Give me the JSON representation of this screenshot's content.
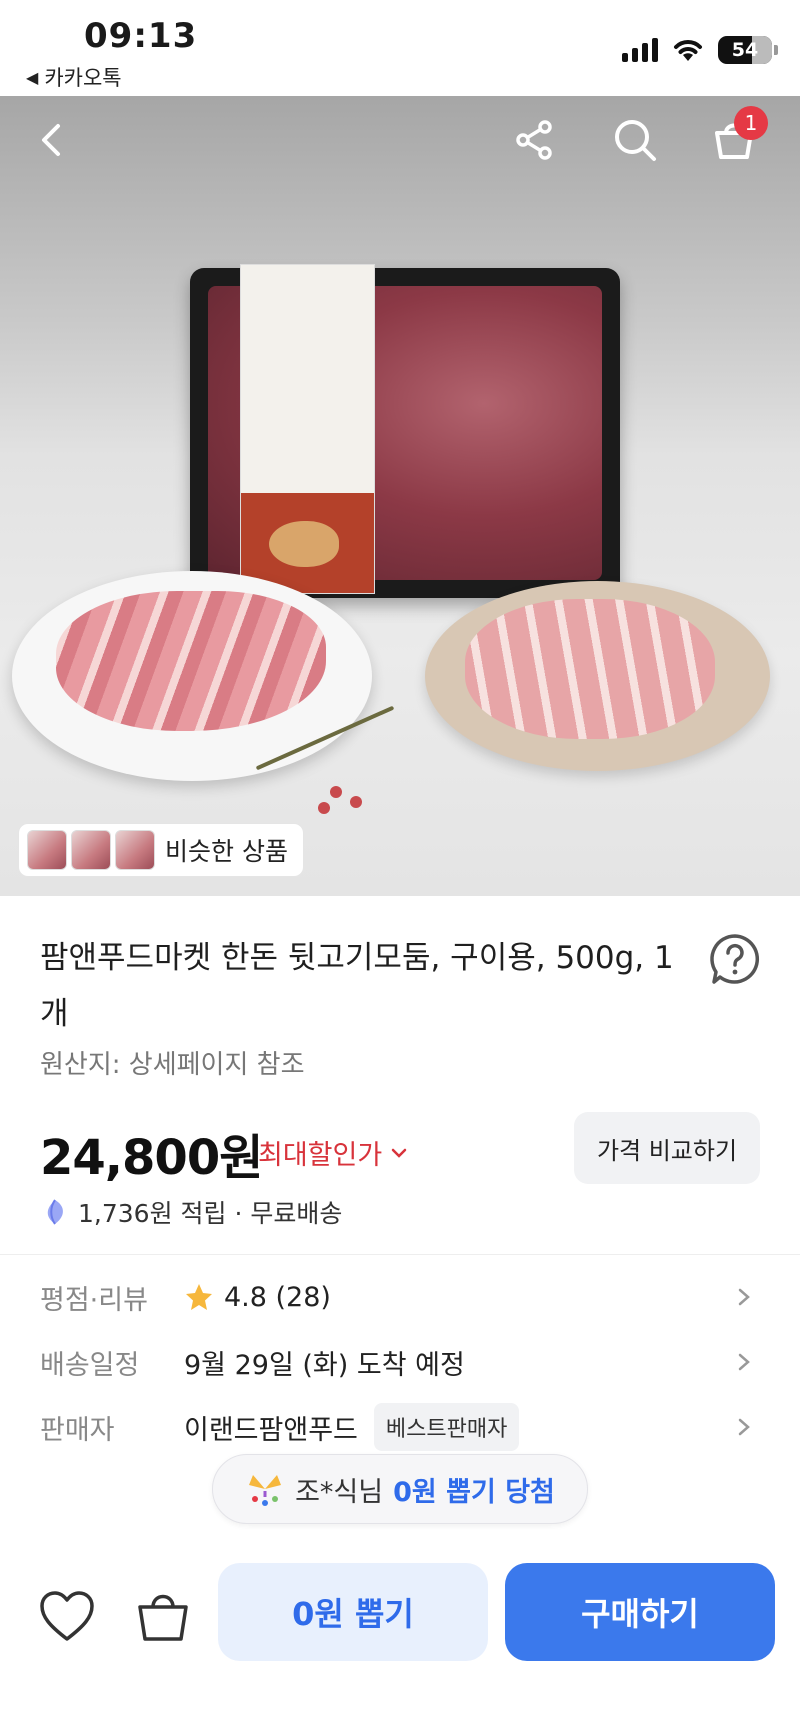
{
  "status_bar": {
    "time": "09:13",
    "back_app": "카카오톡",
    "battery": "54"
  },
  "header": {
    "cart_count": "1",
    "icons": [
      "back-icon",
      "share-icon",
      "search-icon",
      "cart-icon"
    ]
  },
  "hero": {
    "similar_label": "비슷한 상품"
  },
  "product": {
    "title": "팜앤푸드마켓 한돈 뒷고기모둠, 구이용, 500g, 1개",
    "origin": "원산지: 상세페이지 참조",
    "price": "24,800원",
    "max_discount": "최대할인가",
    "compare_label": "가격 비교하기",
    "points": "1,736원 적립 · 무료배송"
  },
  "info": {
    "rating_key": "평점·리뷰",
    "rating": "4.8 (28)",
    "delivery_key": "배송일정",
    "delivery": "9월 29일 (화) 도착 예정",
    "seller_key": "판매자",
    "seller": "이랜드팜앤푸드",
    "seller_badge": "베스트판매자"
  },
  "banner": {
    "name": "조*식님",
    "highlight": "0원 뽑기 당첨"
  },
  "bottom": {
    "draw_label": "0원 뽑기",
    "buy_label": "구매하기"
  },
  "colors": {
    "accent_blue": "#3b79ec",
    "discount_red": "#d8333b",
    "badge_red": "#e53945",
    "star_yellow": "#f6b73c"
  }
}
